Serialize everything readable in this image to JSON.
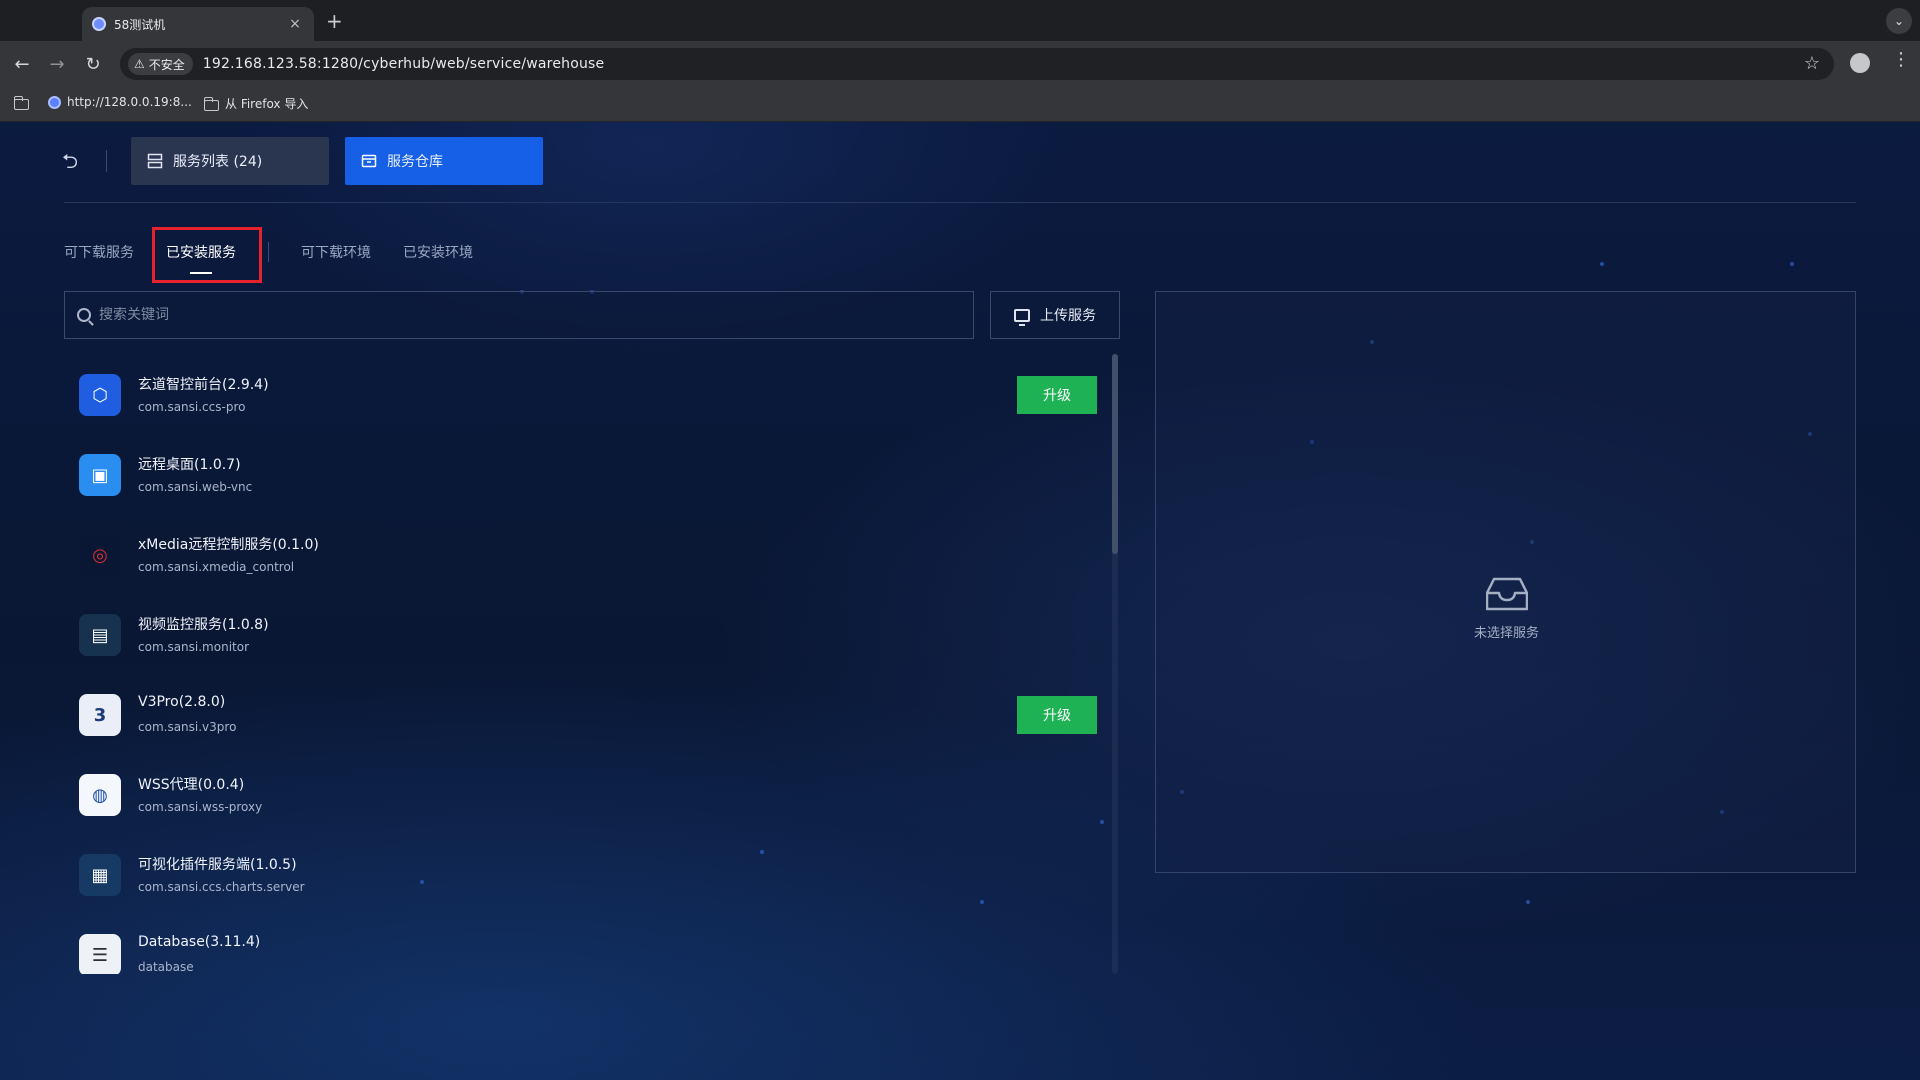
{
  "browser": {
    "tab_title": "58测试机",
    "tab_close": "×",
    "new_tab": "+",
    "tab_menu": "⌄",
    "security_label": "不安全",
    "url": "192.168.123.58:1280/cyberhub/web/service/warehouse",
    "bookmarks": [
      {
        "label": "http://128.0.0.19:8..."
      },
      {
        "label": "从 Firefox 导入"
      }
    ]
  },
  "app": {
    "top_buttons": {
      "service_list": "服务列表 (24)",
      "warehouse": "服务仓库"
    },
    "subtabs": [
      "可下载服务",
      "已安装服务",
      "可下载环境",
      "已安装环境"
    ],
    "active_subtab": "已安装服务",
    "search": {
      "placeholder": "搜索关键词",
      "value": ""
    },
    "upload_label": "上传服务",
    "services": [
      {
        "name": "玄道智控前台(2.9.4)",
        "id": "com.sansi.ccs-pro",
        "upgrade": "升级",
        "icon": "hexagon-app-icon",
        "color": "#1f5ee0"
      },
      {
        "name": "远程桌面(1.0.7)",
        "id": "com.sansi.web-vnc",
        "upgrade": null,
        "icon": "remote-desktop-icon",
        "color": "#2a8df0"
      },
      {
        "name": "xMedia远程控制服务(0.1.0)",
        "id": "com.sansi.xmedia_control",
        "upgrade": null,
        "icon": "xmedia-icon",
        "color": "#0a1734"
      },
      {
        "name": "视频监控服务(1.0.8)",
        "id": "com.sansi.monitor",
        "upgrade": null,
        "icon": "cctv-monitor-icon",
        "color": "#17324f"
      },
      {
        "name": "V3Pro(2.8.0)",
        "id": "com.sansi.v3pro",
        "upgrade": "升级",
        "icon": "v3pro-icon",
        "color": "#e9eef7"
      },
      {
        "name": "WSS代理(0.0.4)",
        "id": "com.sansi.wss-proxy",
        "upgrade": null,
        "icon": "wss-globe-icon",
        "color": "#f4f7fc"
      },
      {
        "name": "可视化插件服务端(1.0.5)",
        "id": "com.sansi.ccs.charts.server",
        "upgrade": null,
        "icon": "charts-server-icon",
        "color": "#163a63"
      },
      {
        "name": "Database(3.11.4)",
        "id": "database",
        "upgrade": null,
        "icon": "database-icon",
        "color": "#eef1f5"
      }
    ],
    "detail": {
      "empty_text": "未选择服务"
    },
    "colors": {
      "accent": "#1560e6",
      "upgrade": "#1fb255",
      "highlight": "#e8222a"
    }
  }
}
